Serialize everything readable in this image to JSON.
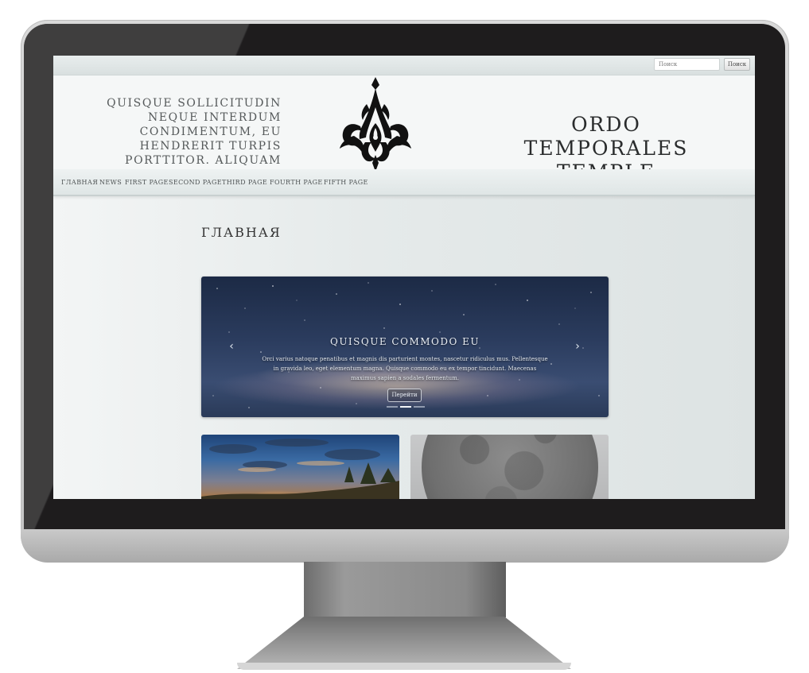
{
  "search": {
    "placeholder": "Поиск",
    "button_label": "Поиск"
  },
  "header": {
    "tagline": "Quisque sollicitudin neque interdum condimentum, eu hendrerit turpis porttitor. Aliquam vehicula lacus.",
    "title": "Ordo Temporales Temple"
  },
  "nav": {
    "items": [
      {
        "label": "Главная"
      },
      {
        "label": "News"
      },
      {
        "label": "First Page"
      },
      {
        "label": "Second Page"
      },
      {
        "label": "Third Page"
      },
      {
        "label": "Fourth Page"
      },
      {
        "label": "Fifth Page"
      }
    ]
  },
  "main": {
    "heading": "Главная",
    "slider": {
      "title": "Quisque commodo eu",
      "text": "Orci varius natoque penatibus et magnis dis parturient montes, nascetur ridiculus mus. Pellentesque in gravida leo, eget elementum magna. Quisque commodo eu ex tempor tincidunt. Maecenas maximus sapien a sodales fermentum.",
      "button_label": "Перейти",
      "prev_glyph": "‹",
      "next_glyph": "›",
      "slide_count": 3,
      "active_slide": 2
    }
  },
  "icons": {
    "logo": "ornamental-assassin-crest-logo",
    "prev": "chevron-left-icon",
    "next": "chevron-right-icon"
  },
  "colors": {
    "page_background": "#e5eaea",
    "header_background": "#f5f7f7",
    "title_text": "#2a2c2d",
    "nav_text": "#4d5253",
    "monitor_bezel": "#1e1c1d"
  }
}
